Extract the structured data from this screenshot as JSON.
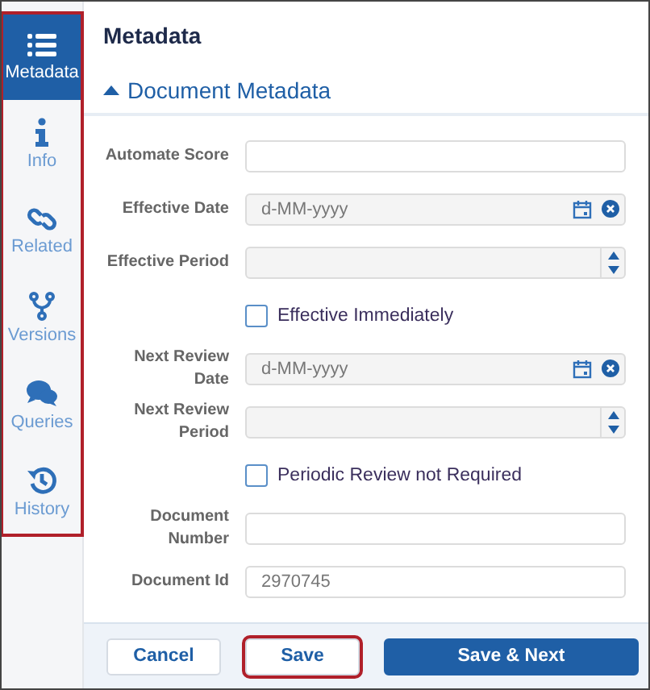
{
  "sidebar": {
    "highlighted": true,
    "items": [
      {
        "label": "Metadata",
        "selected": true
      },
      {
        "label": "Info",
        "selected": false
      },
      {
        "label": "Related",
        "selected": false
      },
      {
        "label": "Versions",
        "selected": false
      },
      {
        "label": "Queries",
        "selected": false
      },
      {
        "label": "History",
        "selected": false
      }
    ]
  },
  "title": "Metadata",
  "section": {
    "title": "Document Metadata",
    "expanded": true
  },
  "fields": [
    {
      "kind": "text",
      "label": "Automate Score"
    },
    {
      "kind": "date",
      "label": "Effective Date",
      "placeholder": "d-MM-yyyy"
    },
    {
      "kind": "spinner",
      "label": "Effective Period"
    },
    {
      "kind": "checkbox",
      "label": "Effective Immediately",
      "checked": false
    },
    {
      "kind": "date",
      "label": "Next Review Date",
      "placeholder": "d-MM-yyyy"
    },
    {
      "kind": "spinner",
      "label": "Next Review Period"
    },
    {
      "kind": "checkbox",
      "label": "Periodic Review not Required",
      "checked": false
    },
    {
      "kind": "text",
      "label": "Document Number"
    },
    {
      "kind": "text",
      "label": "Document Id",
      "value": "2970745"
    }
  ],
  "buttons": [
    {
      "label": "Cancel",
      "kind": "secondary",
      "highlighted": false
    },
    {
      "label": "Save",
      "kind": "secondary",
      "highlighted": true
    },
    {
      "label": "Save & Next",
      "kind": "primary",
      "highlighted": false
    }
  ]
}
